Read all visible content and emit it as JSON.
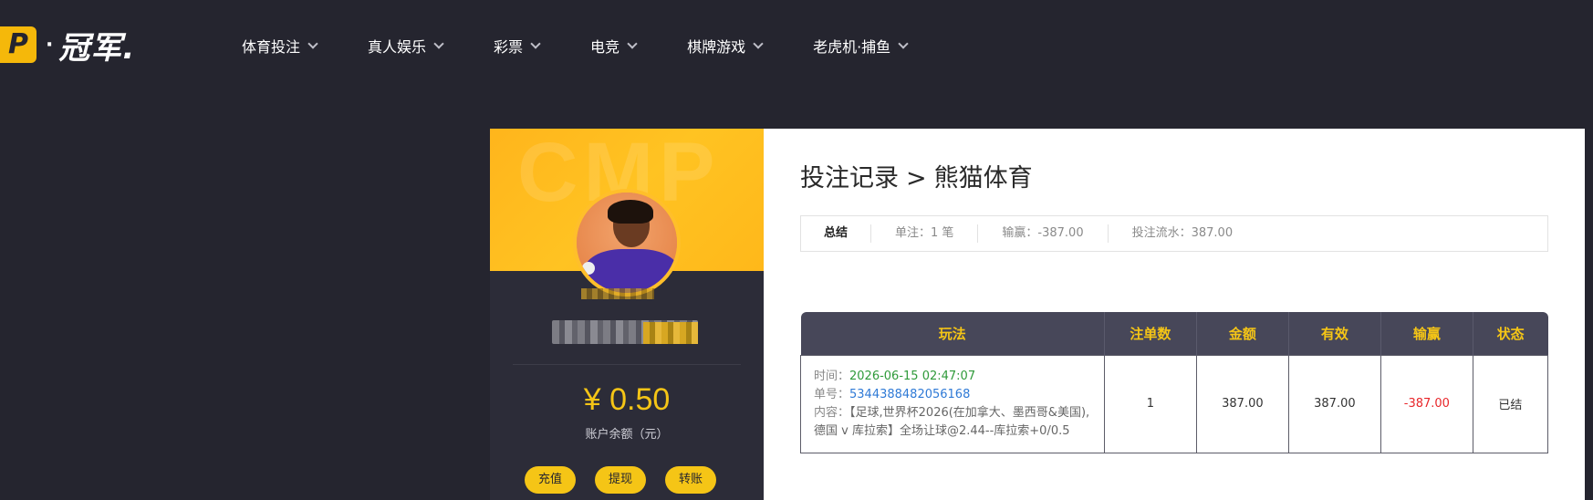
{
  "logo": {
    "box": "P",
    "dot": "·",
    "text": "冠军."
  },
  "nav": [
    {
      "label": "体育投注"
    },
    {
      "label": "真人娱乐"
    },
    {
      "label": "彩票"
    },
    {
      "label": "电竞"
    },
    {
      "label": "棋牌游戏"
    },
    {
      "label": "老虎机·捕鱼"
    }
  ],
  "profile": {
    "watermark": "CMP",
    "balance": "¥ 0.50",
    "balance_label": "账户余额（元）",
    "actions": [
      "充值",
      "提现",
      "转账"
    ]
  },
  "breadcrumb": {
    "section": "投注记录",
    "separator": ">",
    "current": "熊猫体育"
  },
  "summary": {
    "title": "总结",
    "orders": "单注：1 笔",
    "winloss": "输赢：-387.00",
    "turnover": "投注流水：387.00"
  },
  "table": {
    "headers": [
      "玩法",
      "注单数",
      "金额",
      "有效",
      "输赢",
      "状态"
    ],
    "rows": [
      {
        "time_label": "时间：",
        "time": "2026-06-15 02:47:07",
        "order_label": "单号：",
        "order": "5344388482056168",
        "content_label": "内容：",
        "content": "【足球,世界杯2026(在加拿大、墨西哥&美国),德国 v 库拉索】全场让球@2.44--库拉索+0/0.5",
        "count": "1",
        "amount": "387.00",
        "valid": "387.00",
        "winloss": "-387.00",
        "status": "已结"
      }
    ]
  },
  "colors": {
    "accent": "#f5c516",
    "header_bg": "#25252f",
    "table_head": "#474759",
    "loss": "#e8262a"
  }
}
